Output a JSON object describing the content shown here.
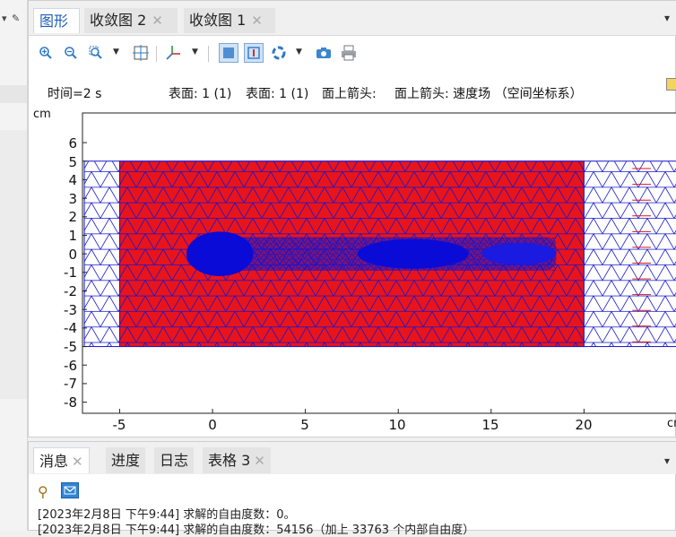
{
  "graphics_tabs": {
    "tab1": "图形",
    "tab2": "收敛图 2",
    "tab3": "收敛图 1"
  },
  "toolbar": {
    "zoom_in": "zoom-in-icon",
    "zoom_out": "zoom-out-icon",
    "zoom_box": "zoom-box-icon",
    "zoom_extents": "zoom-extents-icon",
    "axes": "axes-icon",
    "mesh_view": "mesh-view-icon",
    "transparency": "transparency-icon",
    "scene_light": "scene-light-icon",
    "camera": "camera-icon",
    "print": "print-icon"
  },
  "plot_header": {
    "time": "时间=2 s",
    "surface1": "表面: 1 (1)",
    "surface2": "表面: 1 (1)",
    "arrow1": "面上箭头:",
    "arrow2": "面上箭头: 速度场 （空间坐标系）"
  },
  "plot": {
    "y_unit": "cm",
    "x_unit": "cm",
    "y_ticks": [
      "6",
      "5",
      "4",
      "3",
      "2",
      "1",
      "0",
      "-1",
      "-2",
      "-3",
      "-4",
      "-5",
      "-6",
      "-7",
      "-8"
    ],
    "x_ticks": [
      "-5",
      "0",
      "5",
      "10",
      "15",
      "20"
    ],
    "y_range": [
      -8.6,
      7.6
    ],
    "x_range": [
      -7,
      25
    ],
    "domain_x": [
      -5,
      20
    ],
    "domain_y": [
      -5,
      5
    ],
    "fill_color": "#e8141c",
    "mesh_color": "#1515d0"
  },
  "messages": {
    "tab1": "消息",
    "tab2": "进度",
    "tab3": "日志",
    "tab4": "表格 3",
    "line1": "[2023年2月8日 下午9:44] 求解的自由度数：0。",
    "line2": "[2023年2月8日 下午9:44] 求解的自由度数：54156（加上 33763 个内部自由度）"
  }
}
